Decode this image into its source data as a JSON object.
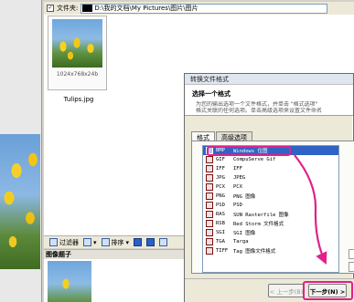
{
  "path_bar": {
    "checkbox_mark": "✓",
    "label": "文件夹:",
    "path": "D:\\我的文档\\My Pictures\\图片\\图片"
  },
  "thumbnail": {
    "size": "1024x768x24b",
    "filename": "Tulips.jpg"
  },
  "toolbar": {
    "filter_label": "过滤器",
    "sort_label": "排序"
  },
  "image_label": {
    "title": "图像题子"
  },
  "dialog": {
    "title": "转换文件格式",
    "header_title": "选择一个格式",
    "header_desc_1": "为您的输出选项一个文件格式，并单击 \"格式选项\"",
    "header_desc_2": "格式关联的任何选项。单击高级选项来设置文件命名",
    "tabs": [
      {
        "label": "格式"
      },
      {
        "label": "高级选项"
      }
    ],
    "formats": [
      {
        "code": "BMP",
        "desc": "Windows 位图"
      },
      {
        "code": "GIF",
        "desc": "CompuServe Gif"
      },
      {
        "code": "IFF",
        "desc": "IFF"
      },
      {
        "code": "JPG",
        "desc": "JPEG"
      },
      {
        "code": "PCX",
        "desc": "PCX"
      },
      {
        "code": "PNG",
        "desc": "PNG 图像"
      },
      {
        "code": "PSD",
        "desc": "PSD"
      },
      {
        "code": "RAS",
        "desc": "SUN Rasterfile 图像"
      },
      {
        "code": "RSB",
        "desc": "Red Storm 文件格式"
      },
      {
        "code": "SGI",
        "desc": "SGI 图像"
      },
      {
        "code": "TGA",
        "desc": "Targa"
      },
      {
        "code": "TIFF",
        "desc": "Tag 图像文件格式"
      }
    ],
    "prev_button": "< 上一步(B)",
    "next_button": "下一步(N) >"
  },
  "colors": {
    "annotation": "#e0218a",
    "selection": "#3163c5"
  }
}
